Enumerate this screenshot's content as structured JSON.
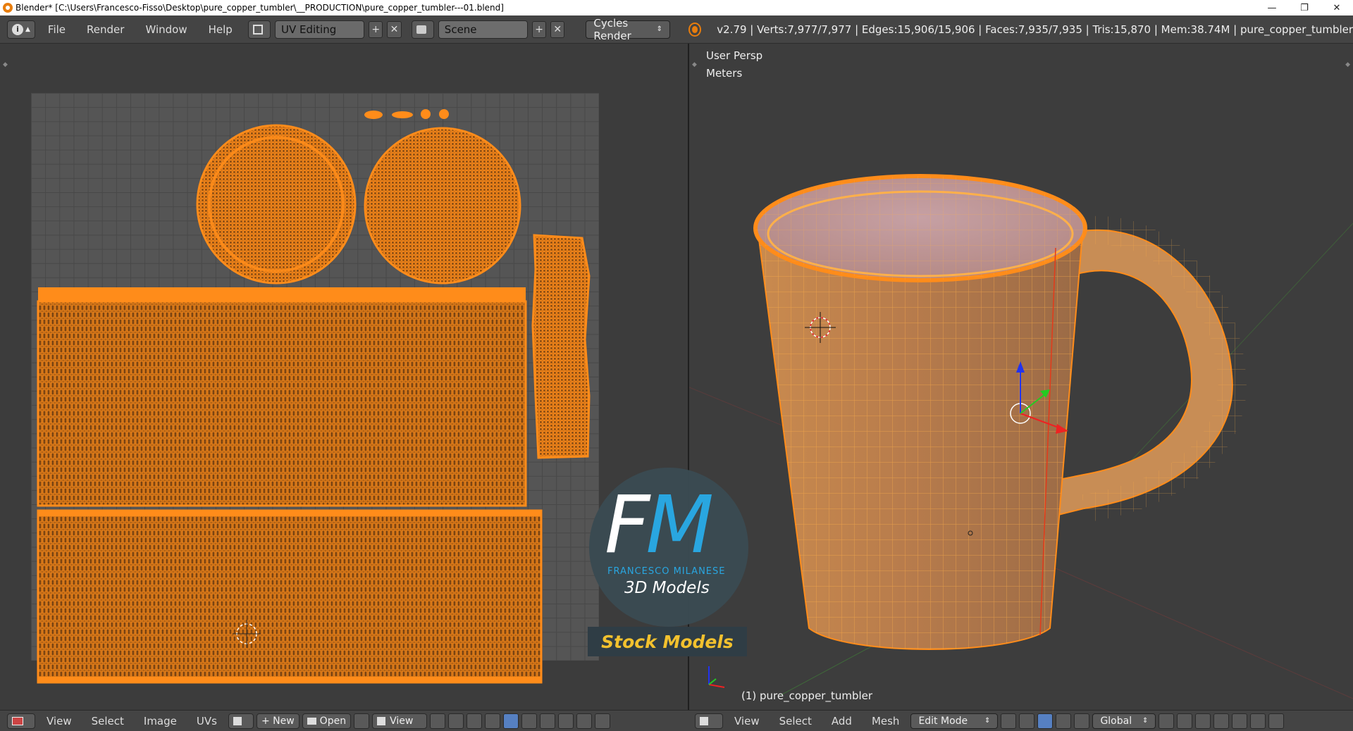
{
  "window": {
    "title": "Blender* [C:\\Users\\Francesco-Fisso\\Desktop\\pure_copper_tumbler\\__PRODUCTION\\pure_copper_tumbler---01.blend]",
    "minimize": "—",
    "maximize": "❐",
    "close": "✕"
  },
  "header": {
    "info_icon": "i",
    "menus": [
      "File",
      "Render",
      "Window",
      "Help"
    ],
    "screen_layout": "UV Editing",
    "scene": "Scene",
    "render_engine": "Cycles Render",
    "stats": "v2.79 | Verts:7,977/7,977 | Edges:15,906/15,906 | Faces:7,935/7,935 | Tris:15,870 | Mem:38.74M | pure_copper_tumbler",
    "add_symbol": "+",
    "remove_symbol": "✕"
  },
  "viewport": {
    "view_name": "User Persp",
    "units": "Meters",
    "object_label": "(1) pure_copper_tumbler"
  },
  "uv_editor_footer": {
    "menus": [
      "View",
      "Select",
      "Image",
      "UVs"
    ],
    "new_label": "New",
    "open_label": "Open",
    "view_label": "View"
  },
  "view3d_footer": {
    "menus": [
      "View",
      "Select",
      "Add",
      "Mesh"
    ],
    "mode": "Edit Mode",
    "orientation": "Global"
  },
  "watermark": {
    "letters_f": "F",
    "letters_m": "M",
    "name": "FRANCESCO MILANESE",
    "tagline": "3D Models",
    "banner": "Stock Models"
  },
  "colors": {
    "mesh_orange": "#ff8c1a",
    "uv_grid": "#555555",
    "logo_blue": "#29a6e0",
    "logo_yellow": "#f2c12e"
  }
}
